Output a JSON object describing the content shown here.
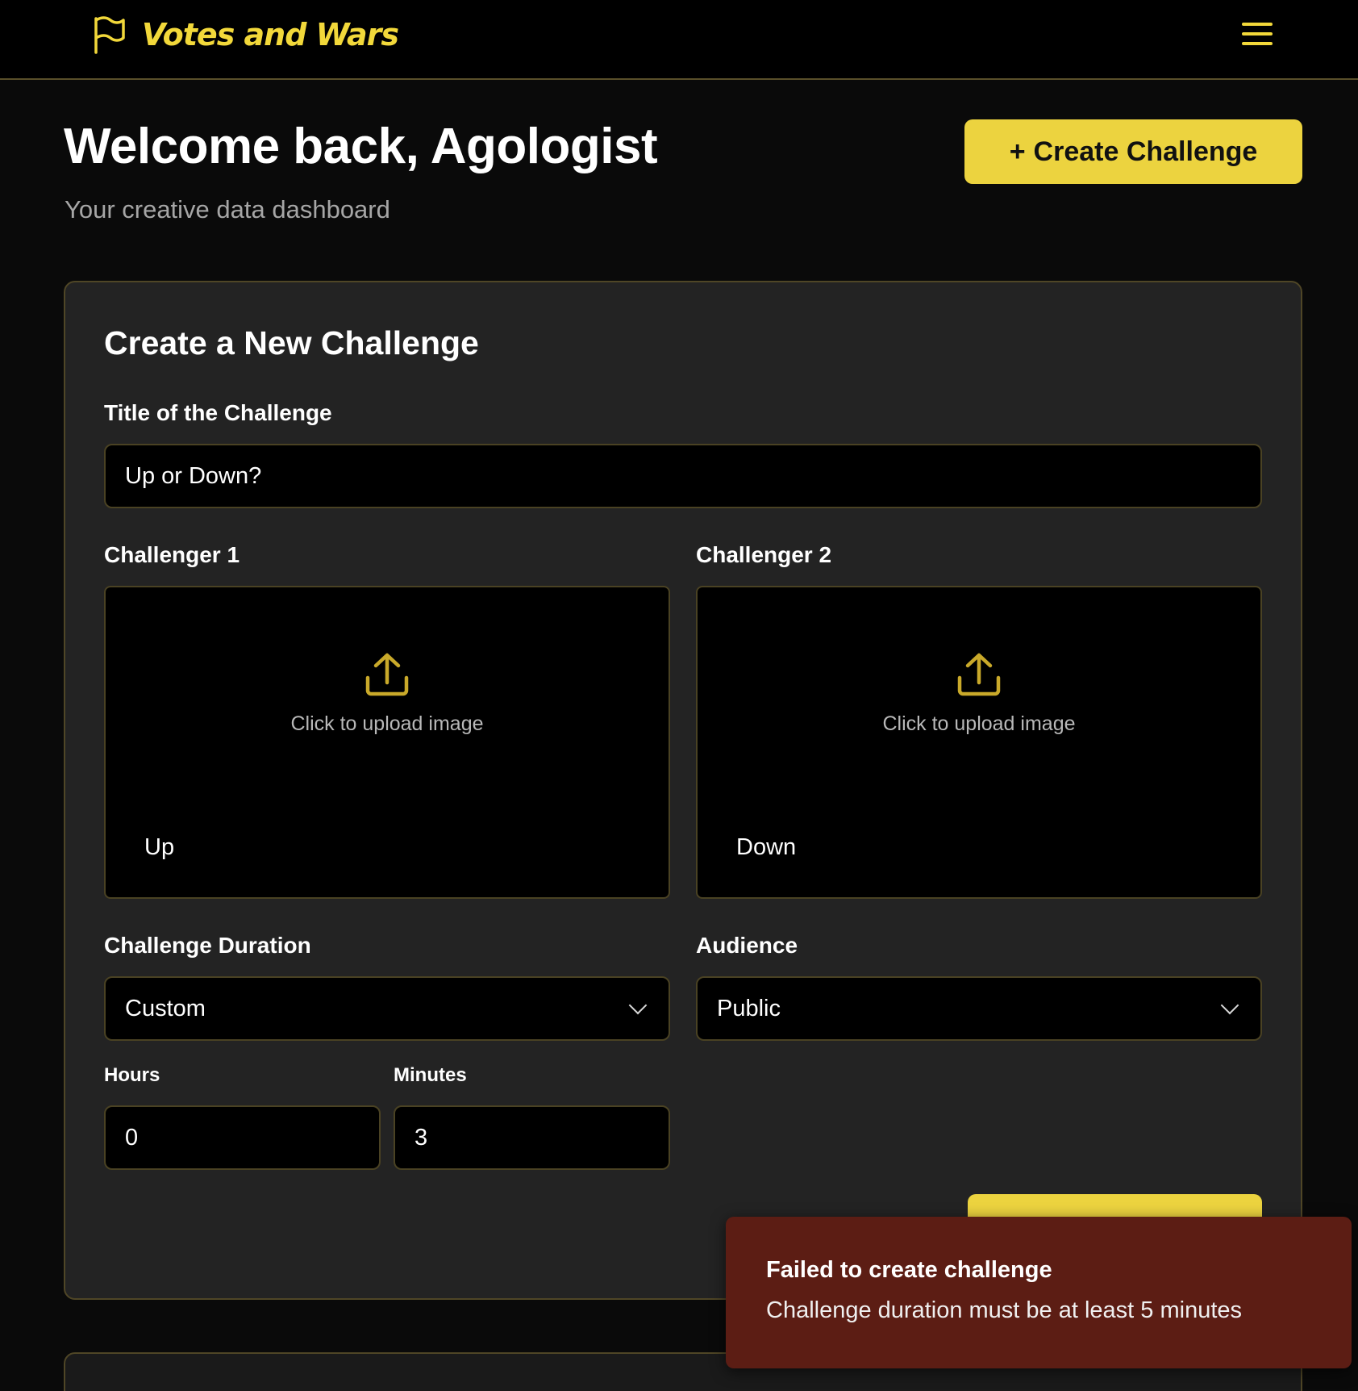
{
  "app": {
    "brand_name": "Votes and Wars",
    "brand_icon": "flag-icon",
    "menu_icon": "hamburger-menu-icon",
    "accent_color": "#ecd33f"
  },
  "hero": {
    "welcome": "Welcome back, Agologist",
    "subtitle": "Your creative data dashboard",
    "create_button_label": "Create Challenge",
    "create_button_icon": "+"
  },
  "form": {
    "heading": "Create a New Challenge",
    "title_label": "Title of the Challenge",
    "title_value": "Up or Down?",
    "challenger1": {
      "label": "Challenger 1",
      "upload_text": "Click to upload image",
      "name": "Up"
    },
    "challenger2": {
      "label": "Challenger 2",
      "upload_text": "Click to upload image",
      "name": "Down"
    },
    "duration": {
      "label": "Challenge Duration",
      "selected": "Custom"
    },
    "audience": {
      "label": "Audience",
      "selected": "Public"
    },
    "hours": {
      "label": "Hours",
      "value": "0"
    },
    "minutes": {
      "label": "Minutes",
      "value": "3"
    }
  },
  "toast": {
    "title": "Failed to create challenge",
    "message": "Challenge duration must be at least 5 minutes",
    "color": "#5c1d14"
  }
}
